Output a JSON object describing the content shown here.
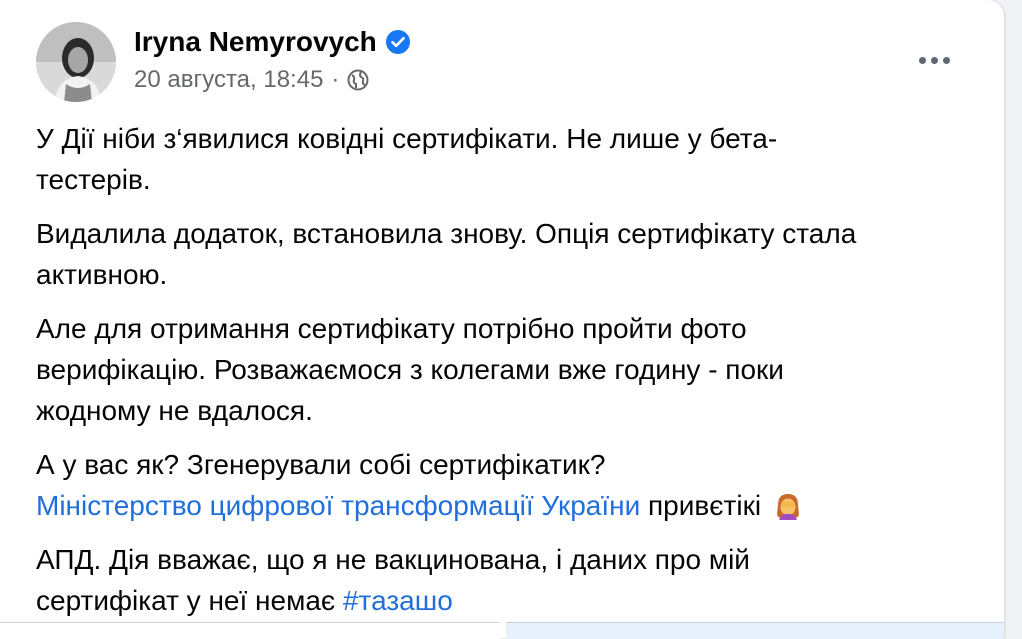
{
  "author": {
    "name": "Iryna Nemyrovych",
    "verified": true
  },
  "post": {
    "date": "20 августа, 18:45",
    "separator": "·",
    "visibility_icon": "globe-icon",
    "paragraphs": {
      "p1_line1": "У Дії ніби з‘явилися ковідні сертифікати. Не лише у бета-",
      "p1_line2": "тестерів.",
      "p2_line1": "Видалила додаток, встановила знову. Опція сертифікату стала",
      "p2_line2": "активною.",
      "p3_line1": "Але для отримання сертифікату потрібно пройти фото",
      "p3_line2": "верифікацію. Розважаємося з колегами вже годину - поки",
      "p3_line3": "жодному не вдалося.",
      "p4_line1": "А у вас як? Згенерували собі сертифікатик?",
      "p4_mention": "Міністерство цифрової трансформації України",
      "p4_after_mention": " привєтікі",
      "p5_line1": "АПД. Дія вважає, що я не вакцинована, і даних про мій",
      "p5_line2_text": "сертифікат у неї немає ",
      "p5_hashtag": "#тазашо"
    },
    "emoji_icon": "facepalm-woman-emoji"
  },
  "colors": {
    "link": "#216fdb",
    "text": "#050505",
    "meta": "#65676b",
    "verified_badge": "#1877f2"
  }
}
